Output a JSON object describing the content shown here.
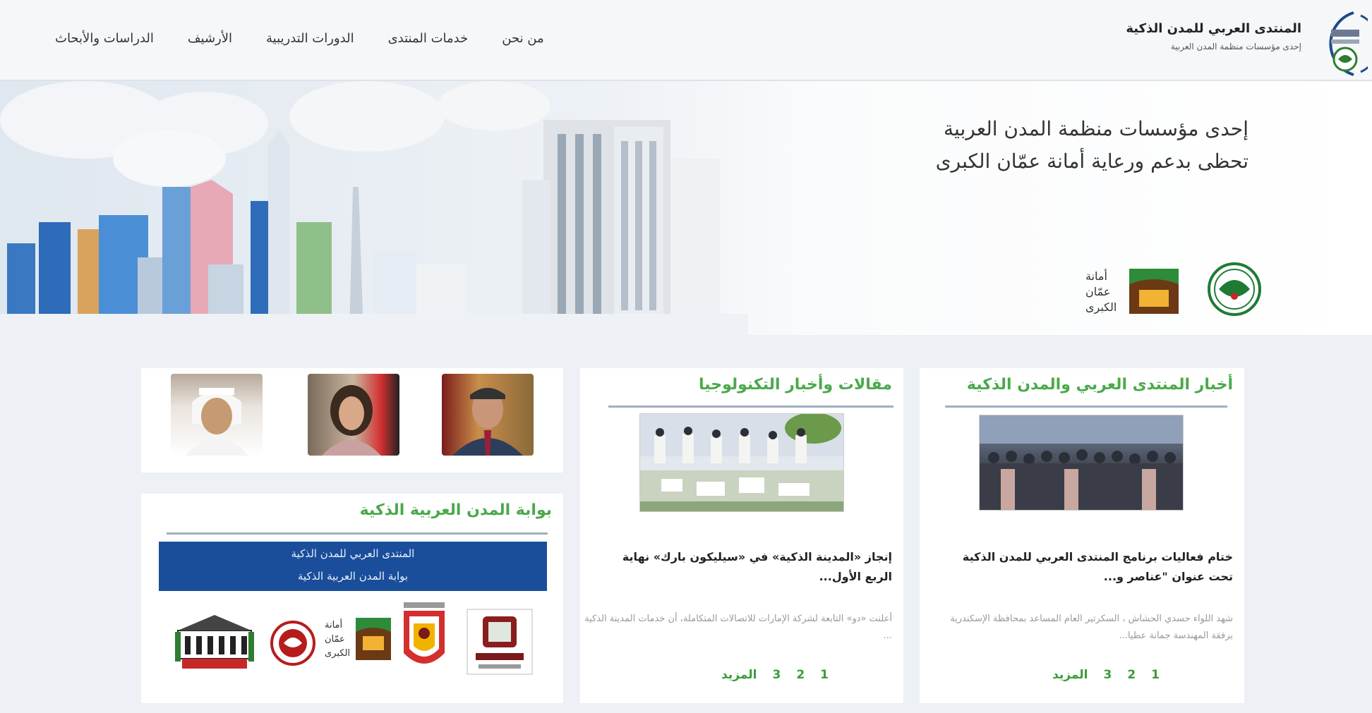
{
  "header": {
    "brand_title": "المنتدى العربي للمدن الذكية",
    "brand_subtitle": "إحدى مؤسسات منظمة المدن العربية",
    "nav": [
      "من نحن",
      "خدمات المنتدى",
      "الدورات التدريبية",
      "الأرشيف",
      "الدراسات والأبحاث"
    ]
  },
  "hero": {
    "line1": "إحدى مؤسسات منظمة المدن العربية",
    "line2": "تحظى بدعم ورعاية أمانة عمّان الكبرى",
    "amman_logo_text": [
      "أمانة",
      "عمّان",
      "الكبرى"
    ]
  },
  "news_forum": {
    "title": "أخبار المنتدى العربي والمدن الذكية",
    "headline": "ختام فعاليات برنامج المنتدى العربي للمدن الذكية تحت عنوان \"عناصر و...",
    "excerpt": "شهد اللواء حسدي الحشاش ، السكرتير العام المساعد بمحافظة الإسكندرية برفقة المهندسة جمانة عطيا...",
    "pages": [
      "1",
      "2",
      "3"
    ],
    "more": "المزيد"
  },
  "news_tech": {
    "title": "مقالات وأخبار التكنولوجيا",
    "headline": "إنجاز «المدينة الذكية» في «سيليكون بارك» نهاية الربع الأول...",
    "excerpt": "أعلنت «دو» التابعة لشركة الإمارات للاتصالات المتكاملة، أن خدمات المدينة الذكية ...",
    "pages": [
      "1",
      "2",
      "3"
    ],
    "more": "المزيد"
  },
  "portal": {
    "title": "بوابة المدن العربية الذكية",
    "banner_line1": "المنتدى العربي للمدن الذكية",
    "banner_line2": "بوابة المدن العربية الذكية"
  },
  "colors": {
    "accent_green": "#4aa94a",
    "banner_blue": "#1a4e9a",
    "header_bg": "#f6f7f9"
  }
}
